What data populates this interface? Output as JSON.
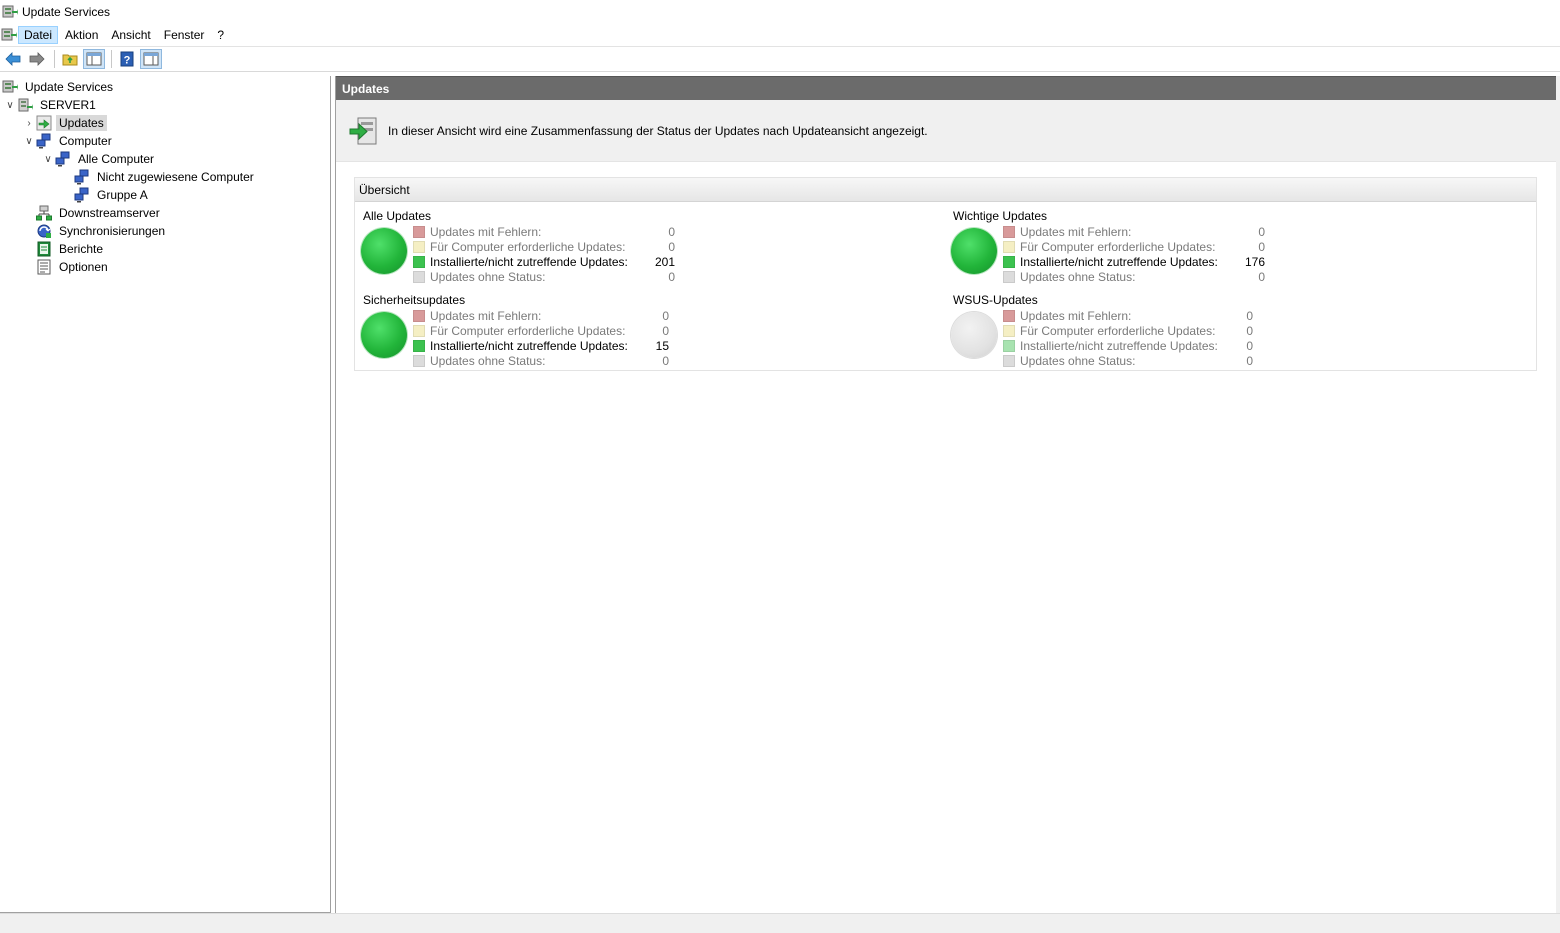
{
  "window": {
    "title": "Update Services"
  },
  "menu": {
    "items": [
      "Datei",
      "Aktion",
      "Ansicht",
      "Fenster",
      "?"
    ]
  },
  "tree": {
    "root": "Update Services",
    "server": "SERVER1",
    "updates": "Updates",
    "computer": "Computer",
    "all_computers": "Alle Computer",
    "unassigned": "Nicht zugewiesene Computer",
    "group_a": "Gruppe A",
    "downstream": "Downstreamserver",
    "sync": "Synchronisierungen",
    "reports": "Berichte",
    "options": "Optionen"
  },
  "main": {
    "header": "Updates",
    "description": "In dieser Ansicht wird eine Zusammenfassung der Status der Updates nach Updateansicht angezeigt.",
    "overview_title": "Übersicht",
    "groups": [
      {
        "title": "Alle Updates",
        "status": "green",
        "stats": [
          {
            "label": "Updates mit Fehlern:",
            "value": "0"
          },
          {
            "label": "Für Computer erforderliche Updates:",
            "value": "0"
          },
          {
            "label": "Installierte/nicht zutreffende Updates:",
            "value": "201"
          },
          {
            "label": "Updates ohne Status:",
            "value": "0"
          }
        ]
      },
      {
        "title": "Wichtige Updates",
        "status": "green",
        "stats": [
          {
            "label": "Updates mit Fehlern:",
            "value": "0"
          },
          {
            "label": "Für Computer erforderliche Updates:",
            "value": "0"
          },
          {
            "label": "Installierte/nicht zutreffende Updates:",
            "value": "176"
          },
          {
            "label": "Updates ohne Status:",
            "value": "0"
          }
        ]
      },
      {
        "title": "Sicherheitsupdates",
        "status": "green",
        "stats": [
          {
            "label": "Updates mit Fehlern:",
            "value": "0"
          },
          {
            "label": "Für Computer erforderliche Updates:",
            "value": "0"
          },
          {
            "label": "Installierte/nicht zutreffende Updates:",
            "value": "15"
          },
          {
            "label": "Updates ohne Status:",
            "value": "0"
          }
        ]
      },
      {
        "title": "WSUS-Updates",
        "status": "grey",
        "stats": [
          {
            "label": "Updates mit Fehlern:",
            "value": "0"
          },
          {
            "label": "Für Computer erforderliche Updates:",
            "value": "0"
          },
          {
            "label": "Installierte/nicht zutreffende Updates:",
            "value": "0"
          },
          {
            "label": "Updates ohne Status:",
            "value": "0"
          }
        ]
      }
    ]
  },
  "colors": {
    "header_bg": "#6b6b6b",
    "status_green": "#22b53a",
    "status_grey": "#e2e2e2",
    "legend_error": "#d89a9a",
    "legend_needed": "#f5efc4",
    "legend_installed": "#3cc24f",
    "legend_nostatus": "#dcdcdc"
  }
}
